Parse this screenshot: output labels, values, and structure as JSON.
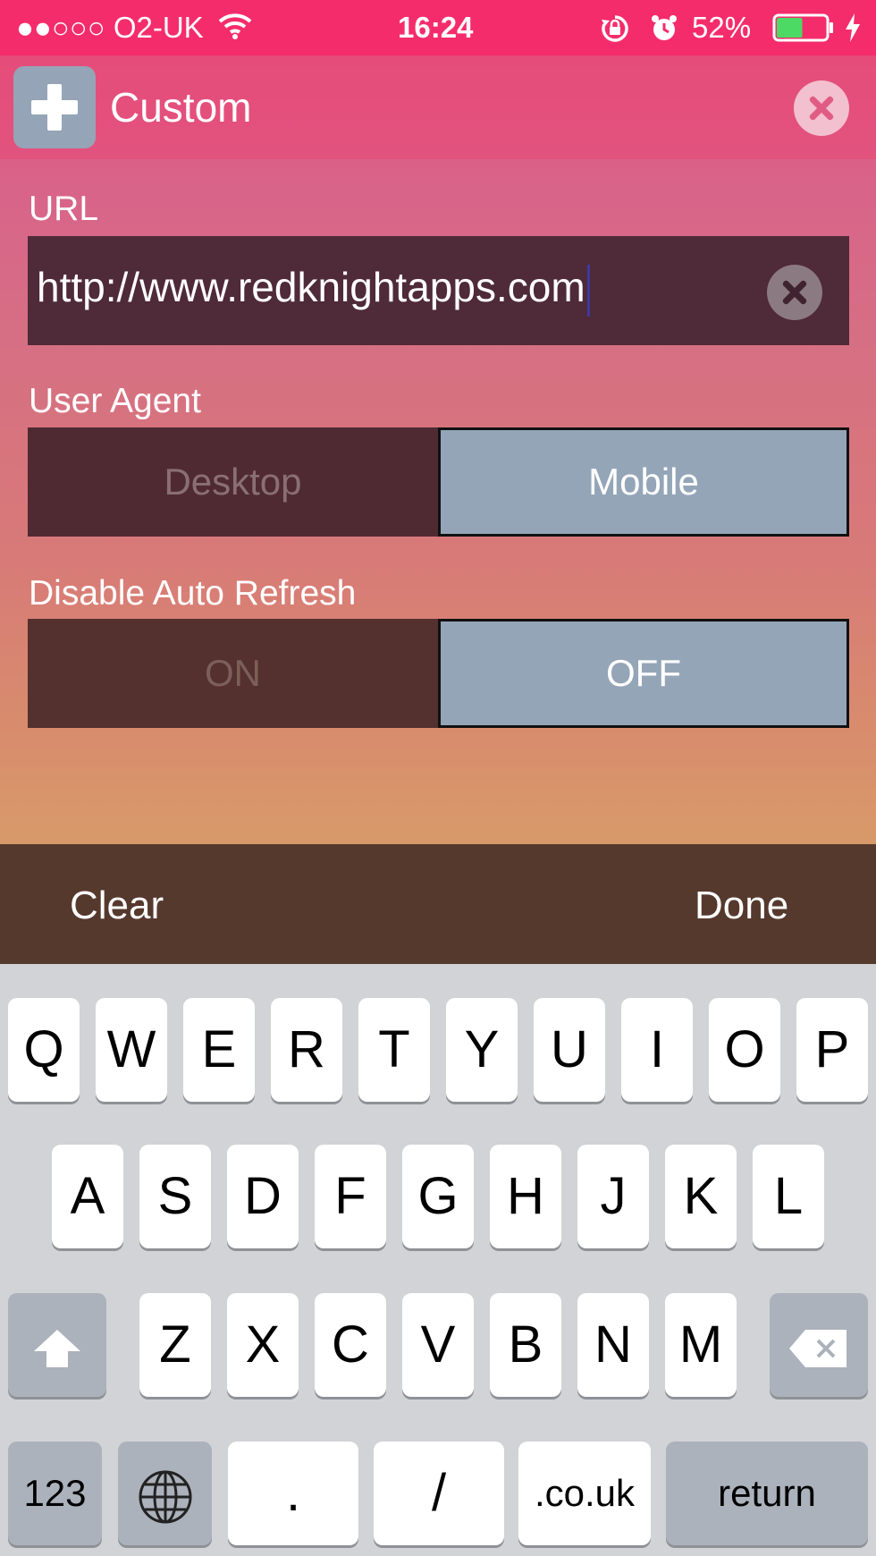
{
  "status_bar": {
    "carrier": "●●○○○ O2-UK",
    "time": "16:24",
    "battery_percent": "52%",
    "battery_level": 0.52,
    "icons": [
      "wifi-icon",
      "orientation-lock-icon",
      "alarm-icon",
      "battery-icon",
      "charging-icon"
    ]
  },
  "header": {
    "title": "Custom",
    "add_icon": "plus-icon",
    "close_icon": "close-icon"
  },
  "form": {
    "url_label": "URL",
    "url_value": "http://www.redknightapps.com",
    "user_agent_label": "User Agent",
    "user_agent_options": [
      "Desktop",
      "Mobile"
    ],
    "user_agent_selected": "Mobile",
    "auto_refresh_label": "Disable Auto Refresh",
    "auto_refresh_options": [
      "ON",
      "OFF"
    ],
    "auto_refresh_selected": "OFF"
  },
  "actions": {
    "clear": "Clear",
    "done": "Done"
  },
  "keyboard": {
    "row1": [
      "Q",
      "W",
      "E",
      "R",
      "T",
      "Y",
      "U",
      "I",
      "O",
      "P"
    ],
    "row2": [
      "A",
      "S",
      "D",
      "F",
      "G",
      "H",
      "J",
      "K",
      "L"
    ],
    "row3": [
      "Z",
      "X",
      "C",
      "V",
      "B",
      "N",
      "M"
    ],
    "numbers": "123",
    "dot": ".",
    "slash": "/",
    "domain": ".co.uk",
    "return": "return"
  },
  "colors": {
    "status_bar": "#f52c6b",
    "selected_segment": "#95a5b8",
    "action_bar": "#56392d"
  }
}
